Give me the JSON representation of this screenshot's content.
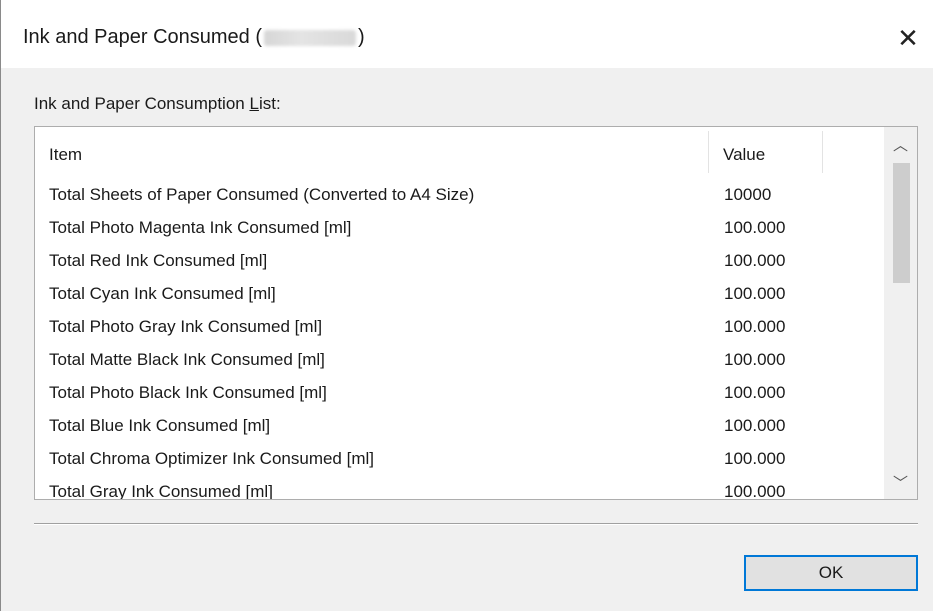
{
  "dialog": {
    "title_prefix": "Ink and Paper Consumed (",
    "title_suffix": ")",
    "close_glyph": "✕"
  },
  "list": {
    "label_before": "Ink and Paper Consumption ",
    "label_underlined": "L",
    "label_after": "ist:",
    "columns": {
      "item": "Item",
      "value": "Value"
    },
    "rows": [
      {
        "item": "Total Sheets of Paper Consumed (Converted to A4 Size)",
        "value": "10000"
      },
      {
        "item": "Total Photo Magenta Ink Consumed [ml]",
        "value": "100.000"
      },
      {
        "item": "Total Red Ink Consumed [ml]",
        "value": "100.000"
      },
      {
        "item": "Total Cyan Ink Consumed [ml]",
        "value": "100.000"
      },
      {
        "item": "Total Photo Gray Ink Consumed [ml]",
        "value": "100.000"
      },
      {
        "item": "Total Matte Black Ink Consumed [ml]",
        "value": "100.000"
      },
      {
        "item": "Total Photo Black Ink Consumed [ml]",
        "value": "100.000"
      },
      {
        "item": "Total Blue Ink Consumed [ml]",
        "value": "100.000"
      },
      {
        "item": "Total Chroma Optimizer Ink Consumed [ml]",
        "value": "100.000"
      },
      {
        "item": "Total Gray Ink Consumed [ml]",
        "value": "100.000"
      }
    ]
  },
  "scrollbar": {
    "up_glyph": "︿",
    "down_glyph": "﹀"
  },
  "buttons": {
    "ok_label": "OK"
  },
  "colors": {
    "accent": "#0078d7",
    "dialog_bg": "#f0f0f0",
    "list_bg": "#ffffff"
  }
}
